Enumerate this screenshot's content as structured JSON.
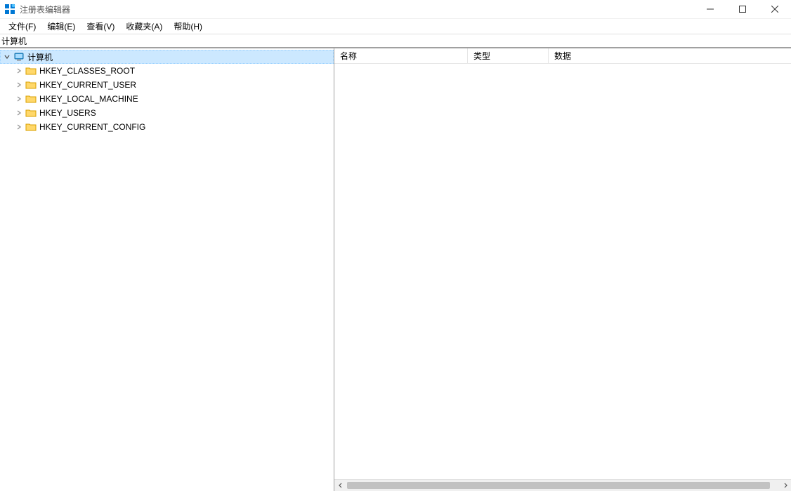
{
  "window": {
    "title": "注册表编辑器"
  },
  "menu": {
    "file": "文件(F)",
    "edit": "编辑(E)",
    "view": "查看(V)",
    "favorites": "收藏夹(A)",
    "help": "帮助(H)"
  },
  "address": {
    "path": "计算机"
  },
  "tree": {
    "root": "计算机",
    "items": [
      {
        "label": "HKEY_CLASSES_ROOT"
      },
      {
        "label": "HKEY_CURRENT_USER"
      },
      {
        "label": "HKEY_LOCAL_MACHINE"
      },
      {
        "label": "HKEY_USERS"
      },
      {
        "label": "HKEY_CURRENT_CONFIG"
      }
    ]
  },
  "columns": {
    "name": "名称",
    "type": "类型",
    "data": "数据"
  }
}
